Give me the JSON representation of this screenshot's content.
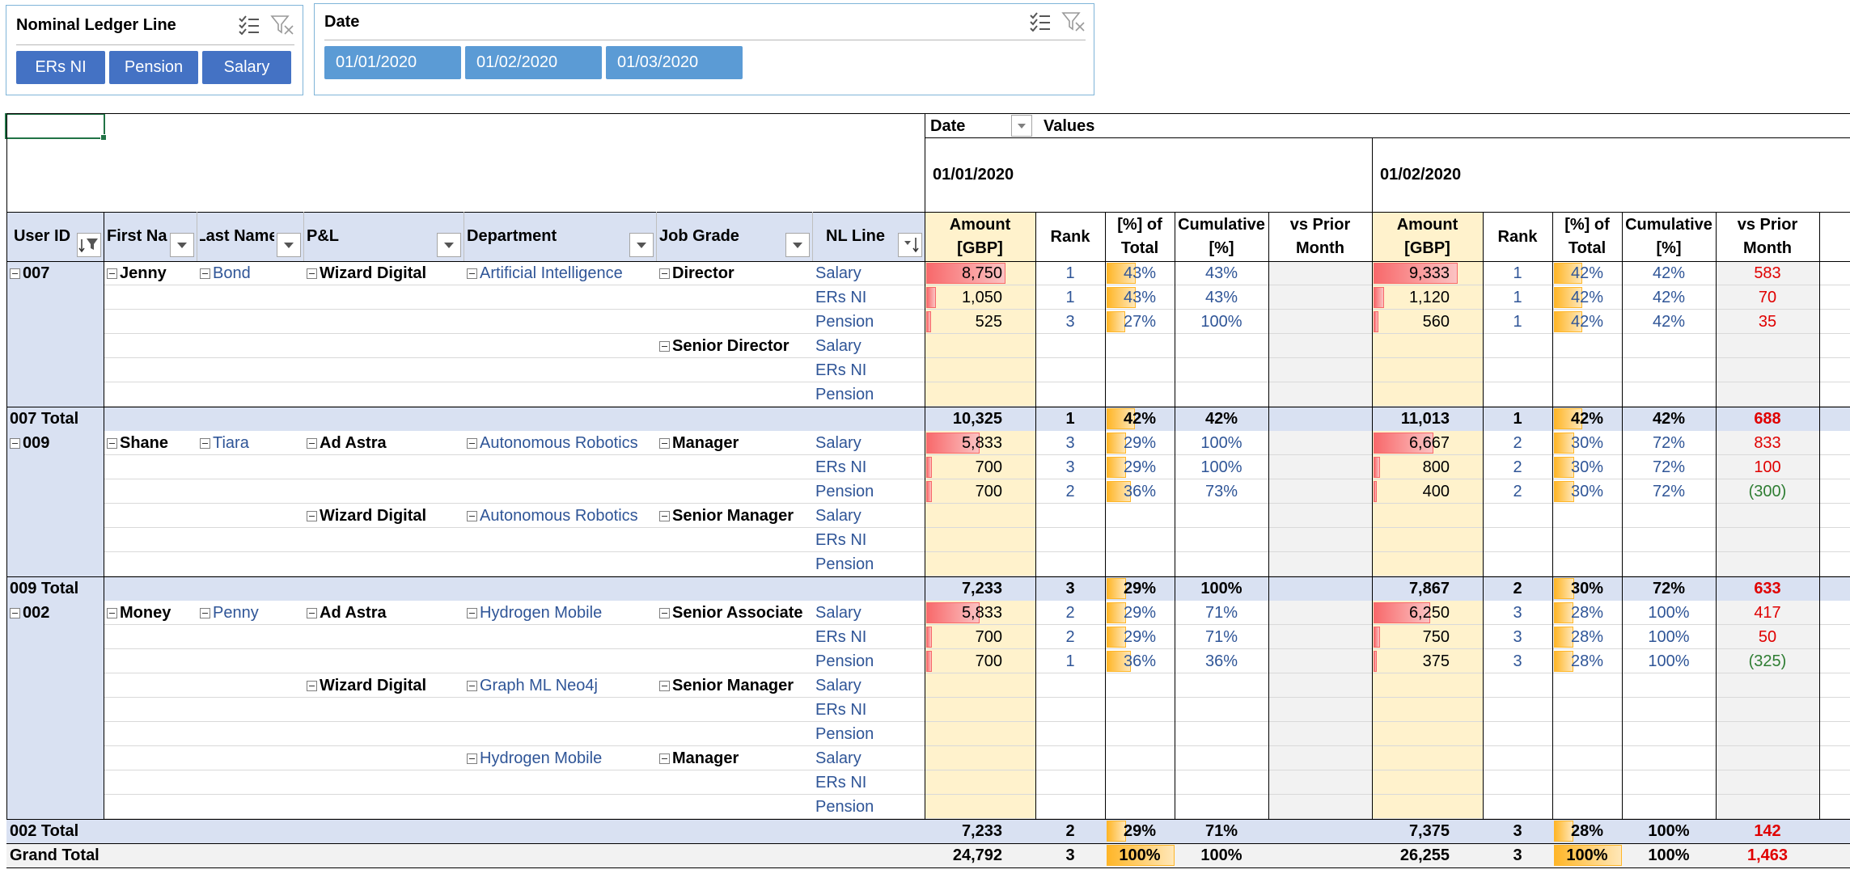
{
  "slicers": {
    "nominal": {
      "title": "Nominal Ledger Line",
      "items": [
        "ERs NI",
        "Pension",
        "Salary"
      ],
      "icons": [
        "multi-select-icon",
        "clear-filter-icon"
      ]
    },
    "date": {
      "title": "Date",
      "items": [
        "01/01/2020",
        "01/02/2020",
        "01/03/2020"
      ],
      "icons": [
        "multi-select-icon",
        "clear-filter-icon"
      ]
    }
  },
  "pivot": {
    "column_field": "Date",
    "values_label": "Values",
    "date_groups": [
      "01/01/2020",
      "01/02/2020"
    ],
    "row_headers": [
      "User ID",
      "First Name",
      "Last Name",
      "P&L",
      "Department",
      "Job Grade",
      "NL Line"
    ],
    "value_headers": [
      [
        "Amount",
        "[GBP]"
      ],
      [
        "Rank"
      ],
      [
        "[%] of",
        "Total"
      ],
      [
        "Cumulative",
        "[%]"
      ],
      [
        "vs Prior",
        "Month"
      ]
    ],
    "rows": [
      {
        "type": "data",
        "labels": {
          "user": "007",
          "first": "Jenny",
          "last": "Bond",
          "pl": "Wizard Digital",
          "dept": "Artificial Intelligence",
          "grade": "Director"
        },
        "nl": "Salary",
        "g1": {
          "amt": "8,750",
          "rank": "1",
          "pct": "43%",
          "cum": "43%",
          "vs": "",
          "bar_amt": 0.92,
          "bar_pct": 0.43
        },
        "g2": {
          "amt": "9,333",
          "rank": "1",
          "pct": "42%",
          "cum": "42%",
          "vs": "583",
          "vs_color": "red",
          "bar_amt": 0.98,
          "bar_pct": 0.42
        }
      },
      {
        "type": "data",
        "labels": {},
        "nl": "ERs NI",
        "g1": {
          "amt": "1,050",
          "rank": "1",
          "pct": "43%",
          "cum": "43%",
          "vs": "",
          "bar_amt": 0.11,
          "bar_pct": 0.43
        },
        "g2": {
          "amt": "1,120",
          "rank": "1",
          "pct": "42%",
          "cum": "42%",
          "vs": "70",
          "vs_color": "red",
          "bar_amt": 0.12,
          "bar_pct": 0.42
        }
      },
      {
        "type": "data",
        "labels": {},
        "nl": "Pension",
        "g1": {
          "amt": "525",
          "rank": "3",
          "pct": "27%",
          "cum": "100%",
          "vs": "",
          "bar_amt": 0.055,
          "bar_pct": 0.27
        },
        "g2": {
          "amt": "560",
          "rank": "1",
          "pct": "42%",
          "cum": "42%",
          "vs": "35",
          "vs_color": "red",
          "bar_amt": 0.06,
          "bar_pct": 0.42
        }
      },
      {
        "type": "data",
        "labels": {
          "grade": "Senior Director"
        },
        "nl": "Salary",
        "g1": {},
        "g2": {}
      },
      {
        "type": "data",
        "labels": {},
        "nl": "ERs NI",
        "g1": {},
        "g2": {}
      },
      {
        "type": "data",
        "labels": {},
        "nl": "Pension",
        "g1": {},
        "g2": {}
      },
      {
        "type": "total",
        "label": "007 Total",
        "g1": {
          "amt": "10,325",
          "rank": "1",
          "pct": "42%",
          "cum": "42%",
          "vs": "",
          "bar_pct": 0.42
        },
        "g2": {
          "amt": "11,013",
          "rank": "1",
          "pct": "42%",
          "cum": "42%",
          "vs": "688",
          "vs_color": "red",
          "bar_pct": 0.42
        }
      },
      {
        "type": "data",
        "labels": {
          "user": "009",
          "first": "Shane",
          "last": "Tiara",
          "pl": "Ad Astra",
          "dept": "Autonomous Robotics",
          "grade": "Manager"
        },
        "nl": "Salary",
        "g1": {
          "amt": "5,833",
          "rank": "3",
          "pct": "29%",
          "cum": "100%",
          "vs": "",
          "bar_amt": 0.62,
          "bar_pct": 0.29
        },
        "g2": {
          "amt": "6,667",
          "rank": "2",
          "pct": "30%",
          "cum": "72%",
          "vs": "833",
          "vs_color": "red",
          "bar_amt": 0.7,
          "bar_pct": 0.3
        }
      },
      {
        "type": "data",
        "labels": {},
        "nl": "ERs NI",
        "g1": {
          "amt": "700",
          "rank": "3",
          "pct": "29%",
          "cum": "100%",
          "vs": "",
          "bar_amt": 0.07,
          "bar_pct": 0.29
        },
        "g2": {
          "amt": "800",
          "rank": "2",
          "pct": "30%",
          "cum": "72%",
          "vs": "100",
          "vs_color": "red",
          "bar_amt": 0.08,
          "bar_pct": 0.3
        }
      },
      {
        "type": "data",
        "labels": {},
        "nl": "Pension",
        "g1": {
          "amt": "700",
          "rank": "2",
          "pct": "36%",
          "cum": "73%",
          "vs": "",
          "bar_amt": 0.07,
          "bar_pct": 0.36
        },
        "g2": {
          "amt": "400",
          "rank": "2",
          "pct": "30%",
          "cum": "72%",
          "vs": "(300)",
          "vs_color": "green",
          "bar_amt": 0.04,
          "bar_pct": 0.3
        }
      },
      {
        "type": "data",
        "labels": {
          "pl": "Wizard Digital",
          "dept": "Autonomous Robotics",
          "grade": "Senior Manager"
        },
        "nl": "Salary",
        "g1": {},
        "g2": {}
      },
      {
        "type": "data",
        "labels": {},
        "nl": "ERs NI",
        "g1": {},
        "g2": {}
      },
      {
        "type": "data",
        "labels": {},
        "nl": "Pension",
        "g1": {},
        "g2": {}
      },
      {
        "type": "total",
        "label": "009 Total",
        "g1": {
          "amt": "7,233",
          "rank": "3",
          "pct": "29%",
          "cum": "100%",
          "vs": "",
          "bar_pct": 0.29
        },
        "g2": {
          "amt": "7,867",
          "rank": "2",
          "pct": "30%",
          "cum": "72%",
          "vs": "633",
          "vs_color": "red",
          "bar_pct": 0.3
        }
      },
      {
        "type": "data",
        "labels": {
          "user": "002",
          "first": "Money",
          "last": "Penny",
          "pl": "Ad Astra",
          "dept": "Hydrogen Mobile",
          "grade": "Senior Associate"
        },
        "nl": "Salary",
        "g1": {
          "amt": "5,833",
          "rank": "2",
          "pct": "29%",
          "cum": "71%",
          "vs": "",
          "bar_amt": 0.62,
          "bar_pct": 0.29
        },
        "g2": {
          "amt": "6,250",
          "rank": "3",
          "pct": "28%",
          "cum": "100%",
          "vs": "417",
          "vs_color": "red",
          "bar_amt": 0.66,
          "bar_pct": 0.28
        }
      },
      {
        "type": "data",
        "labels": {},
        "nl": "ERs NI",
        "g1": {
          "amt": "700",
          "rank": "2",
          "pct": "29%",
          "cum": "71%",
          "vs": "",
          "bar_amt": 0.07,
          "bar_pct": 0.29
        },
        "g2": {
          "amt": "750",
          "rank": "3",
          "pct": "28%",
          "cum": "100%",
          "vs": "50",
          "vs_color": "red",
          "bar_amt": 0.08,
          "bar_pct": 0.28
        }
      },
      {
        "type": "data",
        "labels": {},
        "nl": "Pension",
        "g1": {
          "amt": "700",
          "rank": "1",
          "pct": "36%",
          "cum": "36%",
          "vs": "",
          "bar_amt": 0.07,
          "bar_pct": 0.36
        },
        "g2": {
          "amt": "375",
          "rank": "3",
          "pct": "28%",
          "cum": "100%",
          "vs": "(325)",
          "vs_color": "green",
          "bar_amt": 0.04,
          "bar_pct": 0.28
        }
      },
      {
        "type": "data",
        "labels": {
          "pl": "Wizard Digital",
          "dept": "Graph ML Neo4j",
          "grade": "Senior Manager"
        },
        "nl": "Salary",
        "g1": {},
        "g2": {}
      },
      {
        "type": "data",
        "labels": {},
        "nl": "ERs NI",
        "g1": {},
        "g2": {}
      },
      {
        "type": "data",
        "labels": {},
        "nl": "Pension",
        "g1": {},
        "g2": {}
      },
      {
        "type": "data",
        "labels": {
          "dept": "Hydrogen Mobile",
          "grade": "Manager"
        },
        "nl": "Salary",
        "g1": {},
        "g2": {}
      },
      {
        "type": "data",
        "labels": {},
        "nl": "ERs NI",
        "g1": {},
        "g2": {}
      },
      {
        "type": "data",
        "labels": {},
        "nl": "Pension",
        "g1": {},
        "g2": {}
      },
      {
        "type": "total",
        "label": "002 Total",
        "g1": {
          "amt": "7,233",
          "rank": "2",
          "pct": "29%",
          "cum": "71%",
          "vs": "",
          "bar_pct": 0.29
        },
        "g2": {
          "amt": "7,375",
          "rank": "3",
          "pct": "28%",
          "cum": "100%",
          "vs": "142",
          "vs_color": "red",
          "bar_pct": 0.28
        }
      },
      {
        "type": "grand",
        "label": "Grand Total",
        "g1": {
          "amt": "24,792",
          "rank": "3",
          "pct": "100%",
          "cum": "100%",
          "vs": "",
          "bar_pct": 1.0
        },
        "g2": {
          "amt": "26,255",
          "rank": "3",
          "pct": "100%",
          "cum": "100%",
          "vs": "1,463",
          "vs_color": "red",
          "bar_pct": 1.0
        }
      }
    ]
  },
  "colors": {
    "slicer_selected_dark": "#4472c4",
    "slicer_selected_light": "#5b9bd5",
    "header_blue": "#d9e1f2",
    "amount_fill": "#fff2cc",
    "link_blue": "#2f5597",
    "negative_green": "#2e7d32",
    "positive_red": "#e00000"
  }
}
